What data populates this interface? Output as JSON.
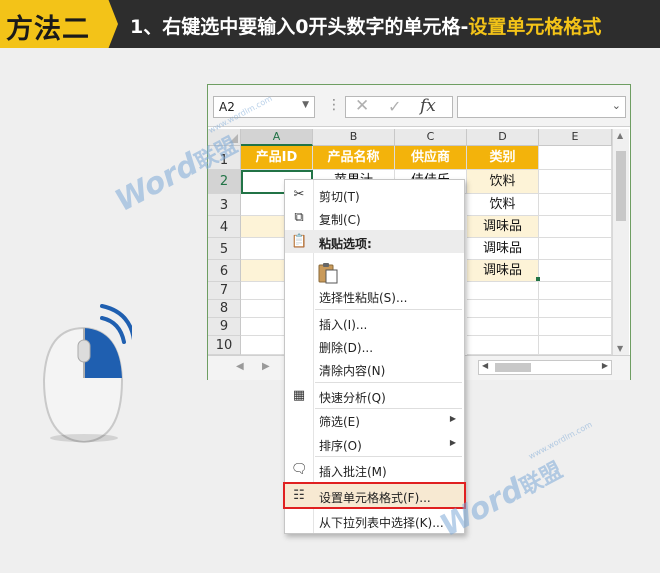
{
  "banner": {
    "badge": "方法二",
    "title_main": "1、右键选中要输入0开头数字的单元格-",
    "title_highlight": "设置单元格格式"
  },
  "excel": {
    "name_box": "A2",
    "columns": [
      "A",
      "B",
      "C",
      "D",
      "E"
    ],
    "rows": [
      "1",
      "2",
      "3",
      "4",
      "5",
      "6",
      "7",
      "8",
      "9",
      "10"
    ],
    "header_row": [
      "产品ID",
      "产品名称",
      "供应商",
      "类别"
    ],
    "cells": {
      "B2": "苹果汁",
      "C2": "佳佳乐",
      "D2": "饮料",
      "D3": "饮料",
      "D4": "调味品",
      "D5": "调味品",
      "D6": "调味品"
    }
  },
  "context_menu": {
    "items": [
      {
        "label": "剪切(T)",
        "icon": "scissors-icon"
      },
      {
        "label": "复制(C)",
        "icon": "copy-icon"
      },
      {
        "label": "粘贴选项:",
        "icon": "paste-icon"
      },
      {
        "label": "选择性粘贴(S)..."
      },
      {
        "label": "插入(I)..."
      },
      {
        "label": "删除(D)..."
      },
      {
        "label": "清除内容(N)"
      },
      {
        "label": "快速分析(Q)",
        "icon": "quick-analysis-icon"
      },
      {
        "label": "筛选(E)"
      },
      {
        "label": "排序(O)"
      },
      {
        "label": "插入批注(M)",
        "icon": "comment-icon"
      },
      {
        "label": "设置单元格格式(F)...",
        "icon": "format-cells-icon"
      },
      {
        "label": "从下拉列表中选择(K)..."
      }
    ]
  },
  "watermark": {
    "brand": "Word",
    "brand_cn": "联盟",
    "url": "www.wordlm.com"
  },
  "colors": {
    "banner_bg": "#2d2d2d",
    "badge": "#f3c318",
    "header_fill": "#f3b30b",
    "highlight_border": "#e02020",
    "excel_green": "#217346"
  }
}
